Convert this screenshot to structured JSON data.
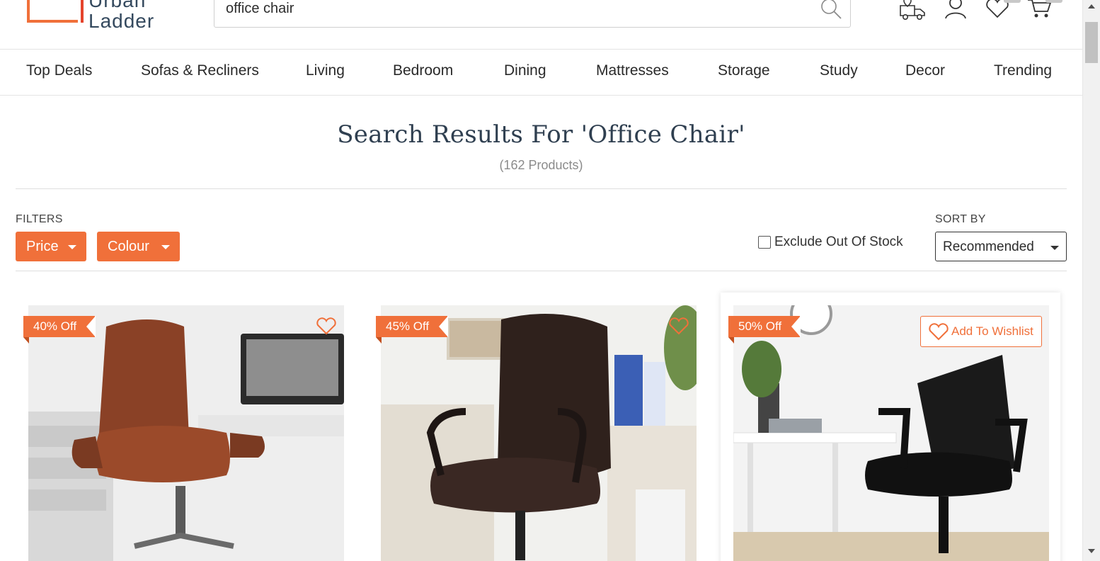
{
  "brand": {
    "name_line1": "Urban",
    "name_line2": "Ladder",
    "color": "#f0703a"
  },
  "search": {
    "value": "office chair",
    "icon": "search-icon"
  },
  "header_icons": [
    "delivery-truck-icon",
    "user-icon",
    "wishlist-heart-icon",
    "cart-icon"
  ],
  "nav": {
    "items": [
      "Top Deals",
      "Sofas & Recliners",
      "Living",
      "Bedroom",
      "Dining",
      "Mattresses",
      "Storage",
      "Study",
      "Decor",
      "Trending"
    ]
  },
  "results": {
    "title": "Search Results For 'Office Chair'",
    "count": "(162 Products)"
  },
  "filters": {
    "label": "FILTERS",
    "buttons": [
      "Price",
      "Colour"
    ],
    "exclude_label": "Exclude Out Of Stock",
    "exclude_checked": false
  },
  "sort": {
    "label": "SORT BY",
    "selected": "Recommended"
  },
  "products": [
    {
      "discount": "40% Off",
      "wishlist_icon": "heart-icon"
    },
    {
      "discount": "45% Off",
      "wishlist_icon": "heart-icon"
    },
    {
      "discount": "50% Off",
      "wishlist_label": "Add To Wishlist"
    }
  ],
  "colors": {
    "accent": "#f0703a",
    "title": "#2f3f50",
    "text": "#2c2c2c"
  }
}
